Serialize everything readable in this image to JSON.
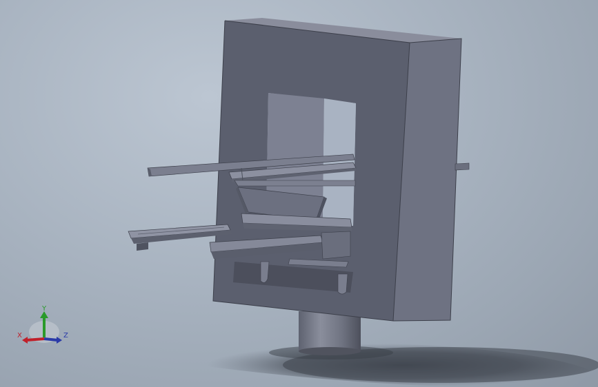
{
  "viewport": {
    "background_top": "#bcc6d2",
    "background_bottom": "#8f99a6"
  },
  "triad": {
    "x_label": "X",
    "y_label": "Y",
    "z_label": "Z",
    "x_color": "#c0202a",
    "y_color": "#2a9a2a",
    "z_color": "#2a3aa8"
  }
}
